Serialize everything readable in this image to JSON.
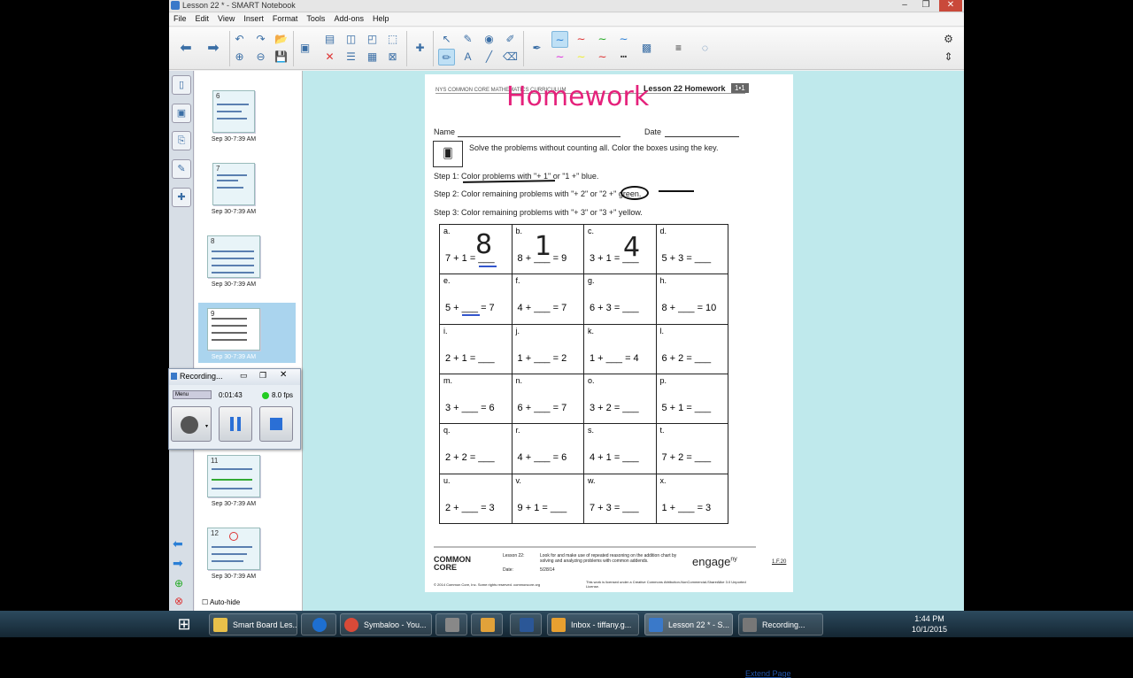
{
  "window": {
    "title": "Lesson 22 * - SMART Notebook",
    "min": "–",
    "max": "❐",
    "close": "✕"
  },
  "menu": [
    "File",
    "Edit",
    "View",
    "Insert",
    "Format",
    "Tools",
    "Add-ons",
    "Help"
  ],
  "thumbnails": [
    {
      "num": "6",
      "label": "Sep 30-7:39 AM"
    },
    {
      "num": "7",
      "label": "Sep 30-7:39 AM"
    },
    {
      "num": "8",
      "label": "Sep 30-7:39 AM"
    },
    {
      "num": "9",
      "label": "Sep 30-7:39 AM"
    },
    {
      "num": "11",
      "label": "Sep 30-7:39 AM"
    },
    {
      "num": "12",
      "label": "Sep 30-7:39 AM"
    }
  ],
  "autohide": "Auto-hide",
  "recording": {
    "title": "Recording...",
    "menu": "Menu",
    "time": "0:01:43",
    "fps": "8.0 fps"
  },
  "worksheet": {
    "header_left": "NYS COMMON CORE MATHEMATICS CURRICULUM",
    "header_right": "Lesson 22 Homework",
    "badge": "1•1",
    "handwritten_title": "Homework",
    "name_label": "Name",
    "date_label": "Date",
    "instructions": "Solve the problems without counting all.  Color the boxes using the key.",
    "step1": "Step 1:  Color problems with \"+ 1\" or \"1 +\" blue.",
    "step2": "Step 2:  Color remaining problems with \"+ 2\" or \"2 +\" green.",
    "step3": "Step 3:  Color remaining problems with \"+ 3\" or \"3 +\" yellow.",
    "problems": [
      {
        "l": "a.",
        "p": "7 + 1 = ___",
        "h": "8"
      },
      {
        "l": "b.",
        "p": "8 + ___ = 9",
        "h": "1"
      },
      {
        "l": "c.",
        "p": "3 + 1 = ___",
        "h": "4"
      },
      {
        "l": "d.",
        "p": "5 + 3 = ___",
        "h": ""
      },
      {
        "l": "e.",
        "p": "5 + ___ = 7",
        "h": ""
      },
      {
        "l": "f.",
        "p": "4 + ___ = 7",
        "h": ""
      },
      {
        "l": "g.",
        "p": "6 + 3 = ___",
        "h": ""
      },
      {
        "l": "h.",
        "p": "8 + ___ = 10",
        "h": ""
      },
      {
        "l": "i.",
        "p": "2 + 1 = ___",
        "h": ""
      },
      {
        "l": "j.",
        "p": "1 + ___ = 2",
        "h": ""
      },
      {
        "l": "k.",
        "p": "1 + ___ = 4",
        "h": ""
      },
      {
        "l": "l.",
        "p": "6 + 2 = ___",
        "h": ""
      },
      {
        "l": "m.",
        "p": "3 + ___ = 6",
        "h": ""
      },
      {
        "l": "n.",
        "p": "6 + ___ = 7",
        "h": ""
      },
      {
        "l": "o.",
        "p": "3 + 2 = ___",
        "h": ""
      },
      {
        "l": "p.",
        "p": "5 + 1 = ___",
        "h": ""
      },
      {
        "l": "q.",
        "p": "2 + 2 = ___",
        "h": ""
      },
      {
        "l": "r.",
        "p": "4 + ___ = 6",
        "h": ""
      },
      {
        "l": "s.",
        "p": "4 + 1 = ___",
        "h": ""
      },
      {
        "l": "t.",
        "p": "7 + 2 = ___",
        "h": ""
      },
      {
        "l": "u.",
        "p": "2 + ___ = 3",
        "h": ""
      },
      {
        "l": "v.",
        "p": "9 + 1 = ___",
        "h": ""
      },
      {
        "l": "w.",
        "p": "7 + 3 = ___",
        "h": ""
      },
      {
        "l": "x.",
        "p": "1 + ___ = 3",
        "h": ""
      }
    ],
    "footer_logo": "COMMON CORE",
    "footer_lesson": "Lesson 22:",
    "footer_date_label": "Date:",
    "footer_desc": "Look for and make use of repeated reasoning on the addition chart by solving and analyzing problems with common addends.",
    "footer_date": "5/28/14",
    "footer_copy": "© 2014 Common Core, Inc. Some rights reserved. commoncore.org",
    "footer_license": "This work is licensed under a Creative Commons Attribution-NonCommercial-ShareAlike 3.0 Unported License.",
    "engage": "engage",
    "engage_sup": "ny",
    "page_code": "1.F.20"
  },
  "extend_page": "Extend Page",
  "taskbar": [
    {
      "label": "Smart Board Les...",
      "color": "#e8c04a"
    },
    {
      "label": "",
      "color": "#1e6fd0"
    },
    {
      "label": "Symbaloo - You...",
      "color": "#d94a38"
    },
    {
      "label": "",
      "color": "#888888"
    },
    {
      "label": "",
      "color": "#e2a23a"
    },
    {
      "label": "",
      "color": "#2b5797"
    },
    {
      "label": "Inbox - tiffany.g...",
      "color": "#e8a030"
    },
    {
      "label": "Lesson 22 * - S...",
      "color": "#3a79c9"
    },
    {
      "label": "Recording...",
      "color": "#777777"
    }
  ],
  "clock": {
    "time": "1:44 PM",
    "date": "10/1/2015"
  }
}
